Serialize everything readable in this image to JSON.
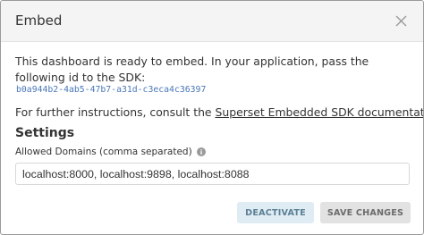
{
  "modal": {
    "title": "Embed",
    "intro_text": "This dashboard is ready to embed. In your application, pass the following id to the SDK:",
    "sdk_id": "b0a944b2-4ab5-47b7-a31d-c3eca4c36397",
    "further_prefix": "For further instructions, consult the ",
    "further_link": "Superset Embedded SDK documentation.",
    "settings_heading": "Settings",
    "domains_label": "Allowed Domains (comma separated)",
    "domains_value": "localhost:8000, localhost:9898, localhost:8088",
    "deactivate_label": "DEACTIVATE",
    "save_label": "SAVE CHANGES"
  },
  "icons": {
    "close": "close-icon",
    "info": "info-icon"
  },
  "colors": {
    "header_bg": "#f4f4f4",
    "sdk_id": "#4a78b8",
    "deactivate_bg": "#e0ecf3",
    "deactivate_text": "#5b7f95",
    "save_bg": "#e2e2e2",
    "save_text": "#6b6b6b"
  }
}
